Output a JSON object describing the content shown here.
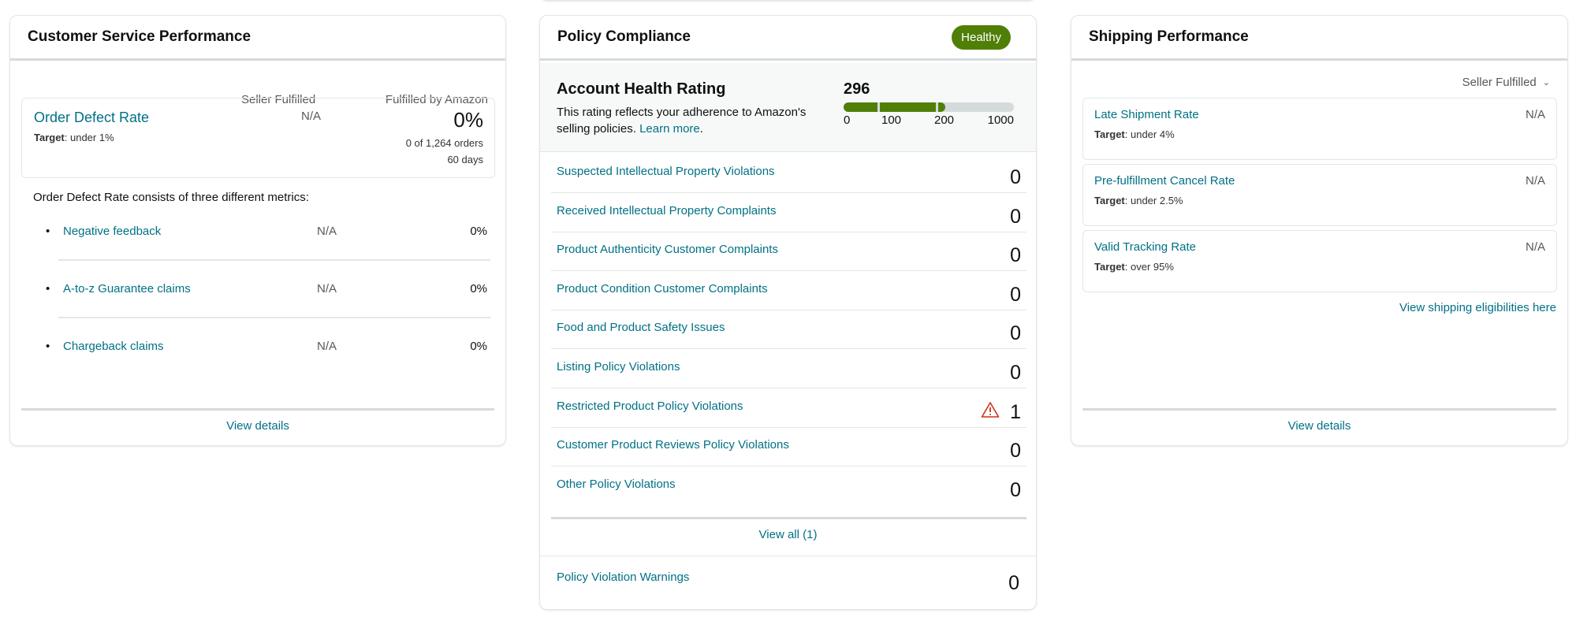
{
  "customer_service": {
    "title": "Customer Service Performance",
    "col_seller": "Seller Fulfilled",
    "col_fba": "Fulfilled by Amazon",
    "odr": {
      "title": "Order Defect Rate",
      "target_label": "Target",
      "target_value": ": under 1%",
      "seller_value": "N/A",
      "fba_value": "0%",
      "orders": "0 of 1,264 orders",
      "days": "60 days"
    },
    "description": "Order Defect Rate consists of three different metrics:",
    "metrics": [
      {
        "name": "Negative feedback",
        "seller": "N/A",
        "fba": "0%"
      },
      {
        "name": "A-to-z Guarantee claims",
        "seller": "N/A",
        "fba": "0%"
      },
      {
        "name": "Chargeback claims",
        "seller": "N/A",
        "fba": "0%"
      }
    ],
    "view_details": "View details"
  },
  "policy_compliance": {
    "title": "Policy Compliance",
    "status_badge": "Healthy",
    "status_color": "#507f07",
    "ahr": {
      "title": "Account Health Rating",
      "description": "This rating reflects your adherence to Amazon's selling policies. ",
      "learn_more": "Learn more",
      "period": ".",
      "score": "296",
      "score_value": 296,
      "scale_ticks": [
        "0",
        "100",
        "200",
        "1000"
      ]
    },
    "items": [
      {
        "name": "Suspected Intellectual Property Violations",
        "count": "0",
        "warning": false
      },
      {
        "name": "Received Intellectual Property Complaints",
        "count": "0",
        "warning": false
      },
      {
        "name": "Product Authenticity Customer Complaints",
        "count": "0",
        "warning": false
      },
      {
        "name": "Product Condition Customer Complaints",
        "count": "0",
        "warning": false
      },
      {
        "name": "Food and Product Safety Issues",
        "count": "0",
        "warning": false
      },
      {
        "name": "Listing Policy Violations",
        "count": "0",
        "warning": false
      },
      {
        "name": "Restricted Product Policy Violations",
        "count": "1",
        "warning": true
      },
      {
        "name": "Customer Product Reviews Policy Violations",
        "count": "0",
        "warning": false
      },
      {
        "name": "Other Policy Violations",
        "count": "0",
        "warning": false
      }
    ],
    "view_all": "View all (1)",
    "warnings": {
      "name": "Policy Violation Warnings",
      "count": "0"
    }
  },
  "shipping": {
    "title": "Shipping Performance",
    "filter": "Seller Fulfilled",
    "metrics": [
      {
        "name": "Late Shipment Rate",
        "target_label": "Target",
        "target_value": ": under 4%",
        "value": "N/A"
      },
      {
        "name": "Pre-fulfillment Cancel Rate",
        "target_label": "Target",
        "target_value": ": under 2.5%",
        "value": "N/A"
      },
      {
        "name": "Valid Tracking Rate",
        "target_label": "Target",
        "target_value": ": over 95%",
        "value": "N/A"
      }
    ],
    "eligibilities_link": "View shipping eligibilities here",
    "view_details": "View details"
  }
}
